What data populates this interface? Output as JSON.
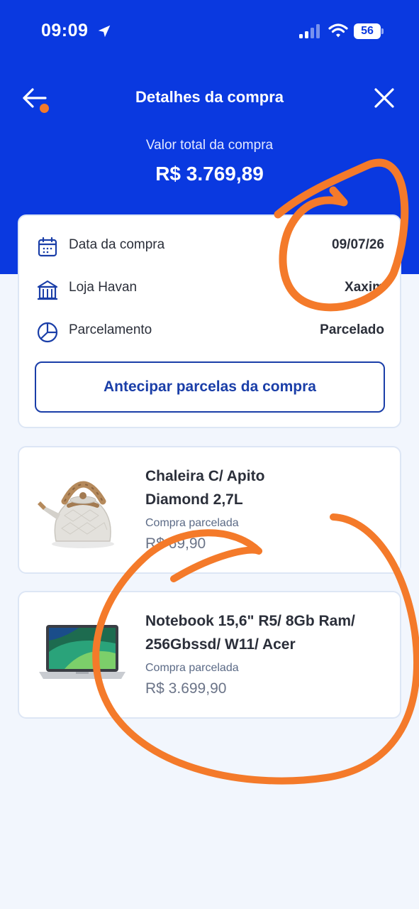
{
  "status_bar": {
    "time": "09:09",
    "battery": "56",
    "icons": [
      "location-arrow-icon",
      "signal-icon",
      "wifi-icon",
      "battery-icon"
    ]
  },
  "nav": {
    "title": "Detalhes da compra",
    "back_icon": "arrow-left-icon",
    "close_icon": "close-icon"
  },
  "summary": {
    "total_label": "Valor total da compra",
    "total_value": "R$ 3.769,89"
  },
  "details": {
    "rows": [
      {
        "icon": "calendar-icon",
        "label": "Data da compra",
        "value": "09/07/26"
      },
      {
        "icon": "store-icon",
        "label": "Loja Havan",
        "value": "Xaxim"
      },
      {
        "icon": "pie-chart-icon",
        "label": "Parcelamento",
        "value": "Parcelado"
      }
    ],
    "anticipate_label": "Antecipar parcelas da compra"
  },
  "products": [
    {
      "name_line1": "Chaleira C/ Apito",
      "name_line2": "Diamond 2,7L",
      "type": "Compra parcelada",
      "price": "R$ 69,90",
      "image": "kettle-image"
    },
    {
      "name_line1": "Notebook 15,6\" R5/ 8Gb Ram/",
      "name_line2": "256Gbssd/ W11/ Acer",
      "type": "Compra parcelada",
      "price": "R$ 3.699,90",
      "image": "laptop-image"
    }
  ],
  "colors": {
    "brand_blue": "#0a39e0",
    "button_blue": "#1a3ea8",
    "annotation_orange": "#f47a2a",
    "background": "#f2f6fd"
  }
}
